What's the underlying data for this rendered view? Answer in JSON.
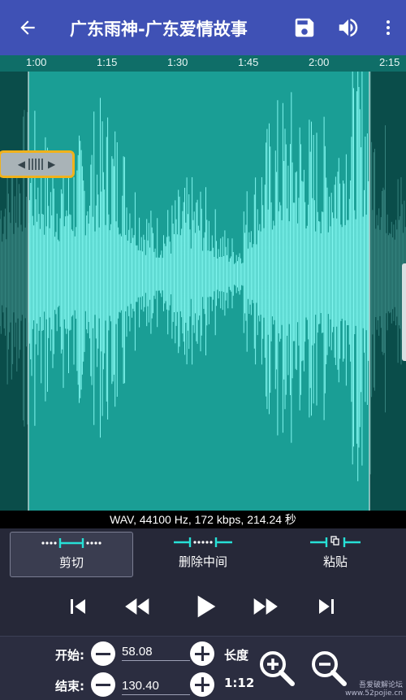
{
  "app_bar": {
    "title": "广东雨神-广东爱情故事",
    "back_icon": "arrow-back-icon",
    "save_icon": "save-icon",
    "volume_icon": "volume-icon",
    "more_icon": "more-vert-icon",
    "color": "#3f51b5"
  },
  "timeline": {
    "ticks": [
      "1:00",
      "1:15",
      "1:30",
      "1:45",
      "2:00",
      "2:15"
    ]
  },
  "waveform": {
    "color": "#7ff5ee",
    "background": "#0e6b66",
    "selection_start": "58.08",
    "selection_end": "130.40"
  },
  "info": {
    "text": "WAV, 44100 Hz, 172 kbps, 214.24 秒"
  },
  "modes": [
    {
      "label": "剪切",
      "icon": "trim-icon",
      "selected": true
    },
    {
      "label": "删除中间",
      "icon": "delete-middle-icon",
      "selected": false
    },
    {
      "label": "粘贴",
      "icon": "paste-icon",
      "selected": false
    }
  ],
  "transport": {
    "icons": [
      "skip-previous-icon",
      "rewind-icon",
      "play-icon",
      "fast-forward-icon",
      "skip-next-icon"
    ]
  },
  "bottom": {
    "start_label": "开始:",
    "start_value": "58.08",
    "end_label": "结束:",
    "end_value": "130.40",
    "length_label": "长度",
    "length_value": "1:12",
    "zoom_in_icon": "zoom-in-icon",
    "zoom_out_icon": "zoom-out-icon"
  },
  "watermark": {
    "line1": "吾爱破解论坛",
    "line2": "www.52pojie.cn"
  }
}
